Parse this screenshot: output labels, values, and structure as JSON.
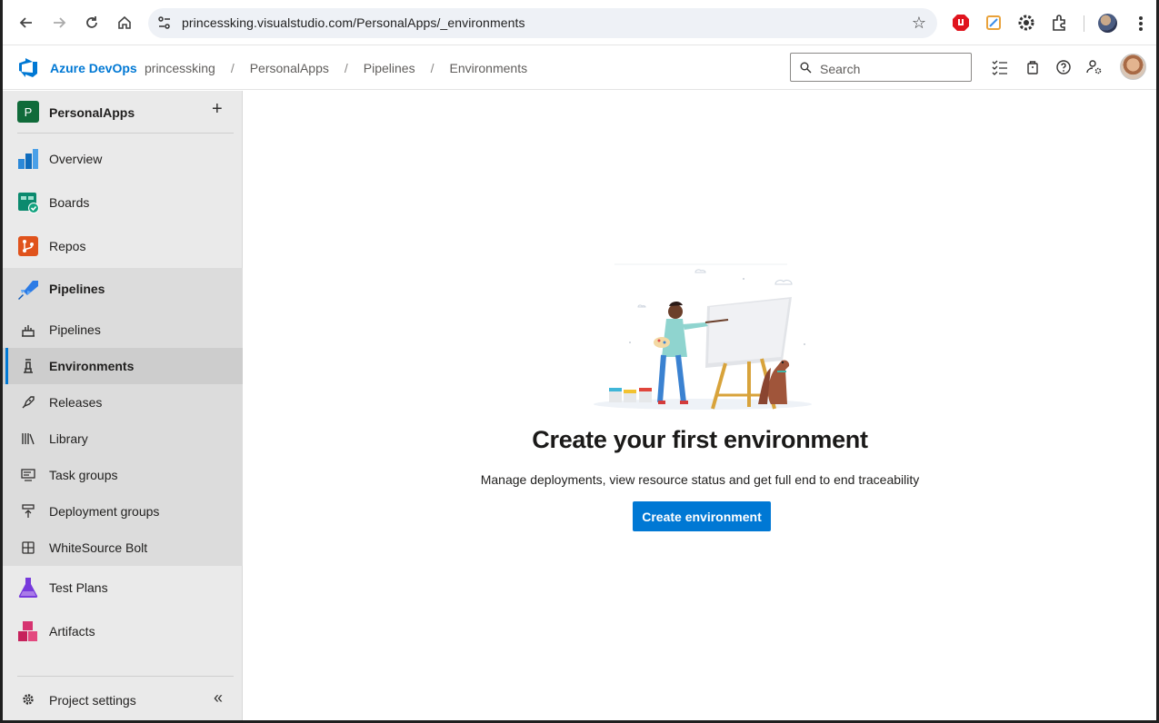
{
  "browser": {
    "url": "princessking.visualstudio.com/PersonalApps/_environments",
    "icons": [
      "back-icon",
      "forward-icon",
      "reload-icon",
      "home-icon",
      "site-settings-icon",
      "bookmark-star-icon",
      "extensions-icon",
      "menu-icon"
    ]
  },
  "header": {
    "brand": "Azure DevOps",
    "breadcrumbs": [
      "princessking",
      "PersonalApps",
      "Pipelines",
      "Environments"
    ],
    "search_placeholder": "Search"
  },
  "sidebar": {
    "project_initial": "P",
    "project_name": "PersonalApps",
    "items": [
      {
        "label": "Overview"
      },
      {
        "label": "Boards"
      },
      {
        "label": "Repos"
      },
      {
        "label": "Pipelines"
      },
      {
        "label": "Test Plans"
      },
      {
        "label": "Artifacts"
      }
    ],
    "pipeline_subitems": [
      {
        "label": "Pipelines"
      },
      {
        "label": "Environments"
      },
      {
        "label": "Releases"
      },
      {
        "label": "Library"
      },
      {
        "label": "Task groups"
      },
      {
        "label": "Deployment groups"
      },
      {
        "label": "WhiteSource Bolt"
      }
    ],
    "settings_label": "Project settings"
  },
  "main": {
    "title": "Create your first environment",
    "description": "Manage deployments, view resource status and get full end to end traceability",
    "button_label": "Create environment"
  },
  "colors": {
    "accent": "#0078d4",
    "project_badge": "#106b3a"
  }
}
